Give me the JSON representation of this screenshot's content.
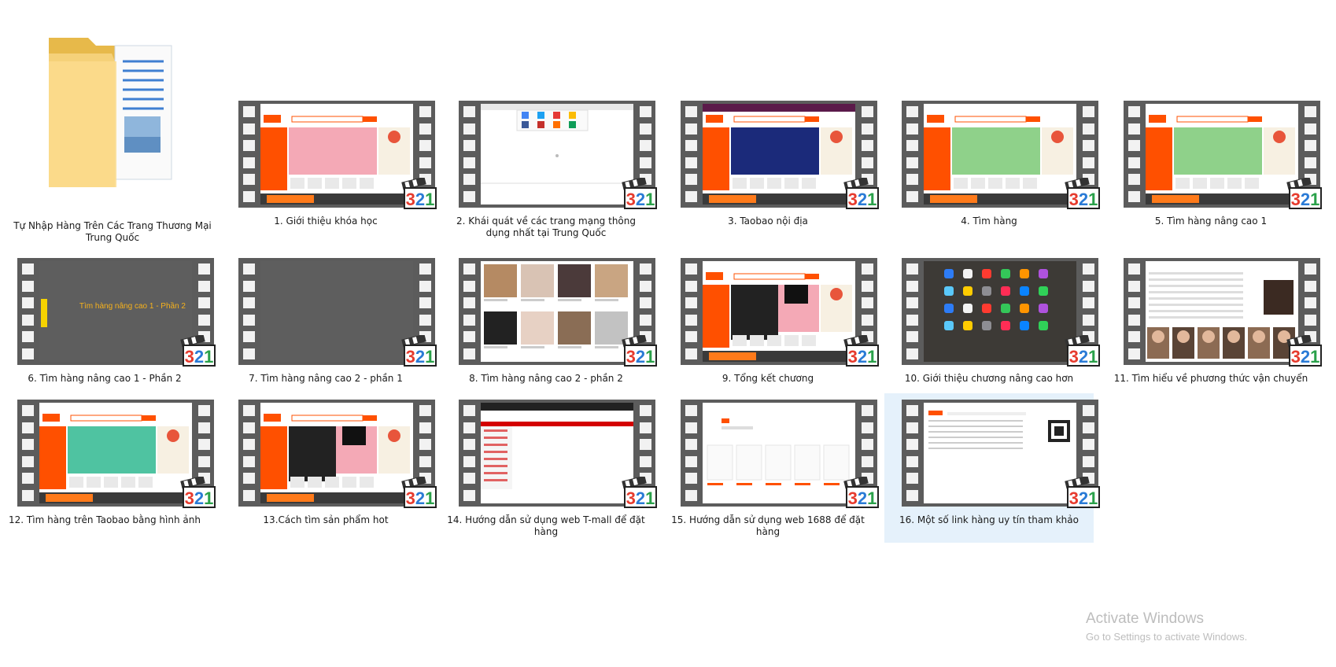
{
  "folder": {
    "label": "Tự Nhập Hàng Trên Các Trang Thương Mại Trung Quốc",
    "icon": "folder-icon"
  },
  "videos": [
    {
      "label": "1. Giới thiệu khóa học",
      "screen": "taobao"
    },
    {
      "label": "2. Khái quát về các trang mạng thông dụng nhất tại Trung Quốc",
      "screen": "browser"
    },
    {
      "label": "3. Taobao nội địa",
      "screen": "taobao-purple"
    },
    {
      "label": "4. Tìm hàng",
      "screen": "taobao-green"
    },
    {
      "label": "5. Tìm hàng nâng cao 1",
      "screen": "taobao-green"
    },
    {
      "label": "6. Tìm hàng nâng cao 1 - Phần 2",
      "screen": "slide",
      "slide_text": "Tìm hàng nâng cao 1 - Phần 2"
    },
    {
      "label": "7. Tìm hàng nâng cao 2 - phần 1",
      "screen": "grey"
    },
    {
      "label": "8. Tìm hàng nâng cao 2 - phần 2",
      "screen": "products"
    },
    {
      "label": "9. Tổng kết chương",
      "screen": "taobao-sale"
    },
    {
      "label": "10. Giới thiệu chương nâng cao hơn",
      "screen": "ios"
    },
    {
      "label": "11. Tìm hiểu về phương thức vận chuyển",
      "screen": "faces"
    },
    {
      "label": "12. Tìm hàng trên Taobao bằng hình ảnh",
      "screen": "taobao-kids"
    },
    {
      "label": "13.Cách tìm sản phẩm hot",
      "screen": "taobao-sale"
    },
    {
      "label": "14. Hướng dẫn sử dụng web T-mall để đặt hàng",
      "screen": "tmall"
    },
    {
      "label": "15. Hướng dẫn sử dụng web 1688 để đặt hàng",
      "screen": "1688"
    },
    {
      "label": "16. Một số link hàng uy tín tham khảo",
      "screen": "links",
      "selected": true
    }
  ],
  "watermark": {
    "title": "Activate Windows",
    "subtitle": "Go to Settings to activate Windows."
  },
  "colors": {
    "selection": "#e5f1fb",
    "taobao_orange": "#ff5000",
    "film": "#5c5c5c"
  }
}
